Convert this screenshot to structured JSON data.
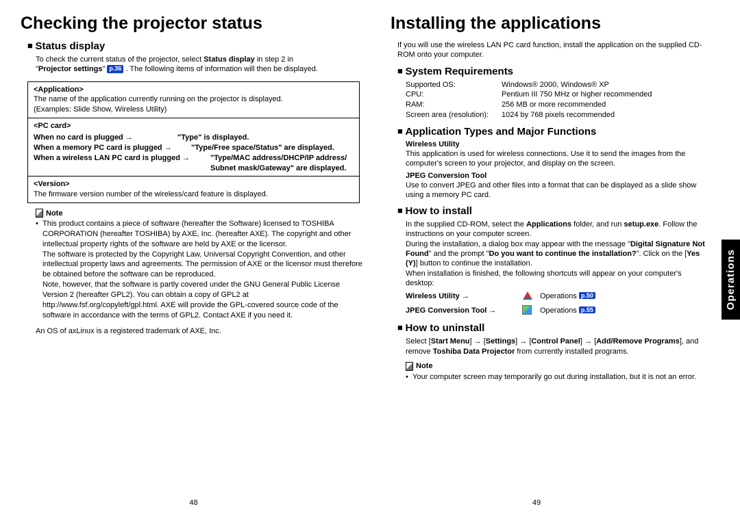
{
  "left": {
    "title": "Checking the projector status",
    "statusDisplay": {
      "heading": "Status display",
      "intro1": "To check the current status of the projector, select ",
      "intro1b": "Status display",
      "intro1c": " in step 2 in",
      "intro2a": "\"",
      "intro2b": "Projector settings",
      "intro2c": "\" ",
      "intro2ref": "p.36",
      "intro2d": " . The following items of information will then be displayed."
    },
    "table": {
      "app": {
        "label": "<Application>",
        "line1": "The name of the application currently running on the projector is displayed.",
        "line2": "(Examples: Slide Show, Wireless Utility)"
      },
      "pccard": {
        "label": "<PC card>",
        "r1a": "When no card is plugged →",
        "r1b": "\"Type\" is displayed.",
        "r2a": "When a memory PC card is plugged →",
        "r2b": "\"Type/Free space/Status\" are displayed.",
        "r3a": "When a wireless LAN PC card is plugged →",
        "r3b": "\"Type/MAC address/DHCP/IP address/",
        "r3c": "Subnet mask/Gateway\" are displayed."
      },
      "version": {
        "label": "<Version>",
        "line": "The firmware version number of the wireless/card feature is displayed."
      }
    },
    "noteHead": "Note",
    "noteBullet1": "This product contains a piece of software (hereafter the Software) licensed to TOSHIBA CORPORATION (hereafter TOSHIBA) by AXE, Inc. (hereafter AXE). The copyright and other intellectual property rights of the software are held by AXE or the licensor.",
    "noteP2": "The software is protected by the Copyright Law, Universal Copyright Convention, and other intellectual property laws and agreements. The permission of AXE or the licensor must therefore be obtained before the software can be reproduced.",
    "noteP3": "Note, however, that the software is partly covered under the GNU General Public License Version 2 (hereafter GPL2). You can obtain a copy of GPL2 at http://www.fsf.org/copyleft/gpl.html. AXE will provide the GPL-covered source code of the software in accordance with the terms of GPL2. Contact AXE if you need it.",
    "footnote": "An OS of axLinux is a registered trademark of AXE, Inc.",
    "pageNum": "48"
  },
  "right": {
    "title": "Installing the applications",
    "intro": "If you will use the wireless LAN PC card function, install the application on the supplied CD-ROM onto your computer.",
    "sysreq": {
      "heading": "System Requirements",
      "rows": [
        {
          "k": "Supported OS:",
          "v": "Windows® 2000, Windows® XP"
        },
        {
          "k": "CPU:",
          "v": "Pentium III 750 MHz or higher recommended"
        },
        {
          "k": "RAM:",
          "v": "256 MB or more recommended"
        },
        {
          "k": "Screen area (resolution):",
          "v": "1024 by 768 pixels recommended"
        }
      ]
    },
    "apptypes": {
      "heading": "Application Types and Major Functions",
      "wuHead": "Wireless Utility",
      "wuBody": "This application is used for wireless connections. Use it to send the images from the computer's screen to your projector, and display on the screen.",
      "jpHead": "JPEG Conversion Tool",
      "jpBody": "Use to convert JPEG and other files into a format that can be displayed as a slide show using a memory PC card."
    },
    "install": {
      "heading": "How to install",
      "p1a": "In the supplied CD-ROM, select the ",
      "p1b": "Applications",
      "p1c": " folder, and run ",
      "p1d": "setup.exe",
      "p1e": ". Follow the instructions on your computer screen.",
      "p2a": "During the installation, a dialog box may appear with the message \"",
      "p2b": "Digital Signature Not Found",
      "p2c": "\" and the prompt \"",
      "p2d": "Do you want to continue the installation?",
      "p2e": "\". Click on the [",
      "p2f": "Yes (Y)",
      "p2g": "] button to continue the installation.",
      "p3": "When installation is finished, the following shortcuts will appear on your computer's desktop:",
      "sc1Label": "Wireless Utility →",
      "sc1Ops": "Operations",
      "sc1Ref": "p.50",
      "sc2Label": "JPEG Conversion Tool →",
      "sc2Ops": "Operations",
      "sc2Ref": "p.55"
    },
    "uninstall": {
      "heading": "How to uninstall",
      "p1a": "Select [",
      "p1b": "Start Menu",
      "p1c": "] → [",
      "p1d": "Settings",
      "p1e": "] → [",
      "p1f": "Control Panel",
      "p1g": "] → [",
      "p1h": "Add/Remove Programs",
      "p1i": "], and remove ",
      "p1j": "Toshiba Data Projector",
      "p1k": " from currently installed programs."
    },
    "noteHead": "Note",
    "noteBullet": "Your computer screen may temporarily go out during installation, but it is not an error.",
    "pageNum": "49"
  },
  "sideTab": "Operations"
}
